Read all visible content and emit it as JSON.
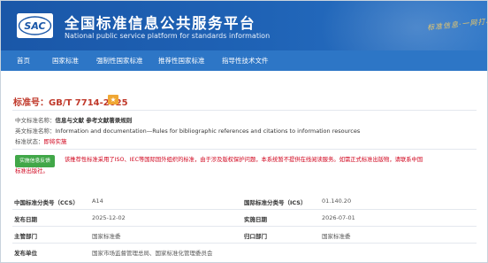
{
  "header": {
    "logo_text": "SAC",
    "title": "全国标准信息公共服务平台",
    "subtitle": "National public service platform  for standards information",
    "slogan": "标准信息·一网打尽"
  },
  "nav": {
    "items": [
      "首页",
      "国家标准",
      "强制性国家标准",
      "推荐性国家标准",
      "指导性技术文件"
    ]
  },
  "standard": {
    "number_label": "标准号：GB/T 7714-2025",
    "badge": "★"
  },
  "info": {
    "cn_name_label": "中文标准名称：",
    "cn_name": "信息与文献 参考文献著录规则",
    "en_name_label": "英文标准名称：",
    "en_name": "Information and documentation—Rules for bibliographic references and citations to information resources",
    "status_label": "标准状态：",
    "status": "即将实施"
  },
  "preview_button": "实施信息反馈",
  "notice": {
    "line1": "该推荐性标准采用了ISO、IEC等国际国外组织的标准，由于涉及版权保护问题，本系统暂不提供在线阅读服务。如需正式标准出版物，请联系中国",
    "line2": "标准出版社。"
  },
  "details": {
    "rows": [
      {
        "l1": "中国标准分类号（CCS）",
        "v1": "A14",
        "l2": "国际标准分类号（ICS）",
        "v2": "01.140.20"
      },
      {
        "l1": "发布日期",
        "v1": "2025-12-02",
        "l2": "实施日期",
        "v2": "2026-07-01"
      },
      {
        "l1": "主管部门",
        "v1": "国家标准委",
        "l2": "归口部门",
        "v2": "国家标准委"
      },
      {
        "l1": "发布单位",
        "v1": "国家市场监督管理总局、国家标准化管理委员会",
        "l2": "",
        "v2": ""
      }
    ]
  },
  "colors": {
    "header_blue": "#1f63b6",
    "nav_blue": "#2d76c6",
    "title_red": "#c0392b",
    "status_red": "#d0021b",
    "button_green": "#41a748",
    "badge_orange": "#f0a734"
  }
}
